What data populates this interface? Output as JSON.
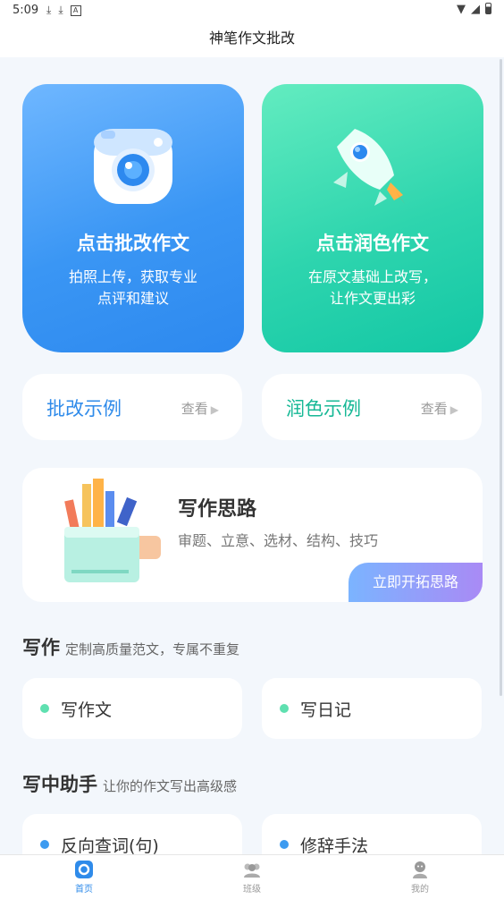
{
  "status": {
    "time": "5:09",
    "left_icons": [
      "download-icon",
      "download-icon",
      "a-icon"
    ],
    "right_icons": [
      "wifi-icon",
      "signal-icon",
      "battery-icon"
    ]
  },
  "title": "神笔作文批改",
  "cards": [
    {
      "title": "点击批改作文",
      "line1": "拍照上传，获取专业",
      "line2": "点评和建议",
      "icon": "camera-icon",
      "color": "#3a96f4"
    },
    {
      "title": "点击润色作文",
      "line1": "在原文基础上改写，",
      "line2": "让作文更出彩",
      "icon": "rocket-icon",
      "color": "#2ed5ae"
    }
  ],
  "examples": [
    {
      "label": "批改示例",
      "view": "查看"
    },
    {
      "label": "润色示例",
      "view": "查看"
    }
  ],
  "thinking": {
    "title": "写作思路",
    "subtitle": "审题、立意、选材、结构、技巧",
    "button": "立即开拓思路"
  },
  "writing": {
    "title": "写作",
    "desc": "定制高质量范文，专属不重复",
    "items": [
      "写作文",
      "写日记"
    ]
  },
  "assist": {
    "title": "写中助手",
    "desc": "让你的作文写出高级感",
    "items": [
      "反向查词(句)",
      "修辞手法"
    ]
  },
  "tabs": [
    {
      "label": "首页",
      "icon": "home-icon"
    },
    {
      "label": "班级",
      "icon": "group-icon"
    },
    {
      "label": "我的",
      "icon": "profile-icon"
    }
  ],
  "colors": {
    "accent_blue": "#2f8bea",
    "accent_green": "#17b896",
    "dot_green": "#5fe0b0",
    "dot_blue": "#3d9bf0"
  }
}
